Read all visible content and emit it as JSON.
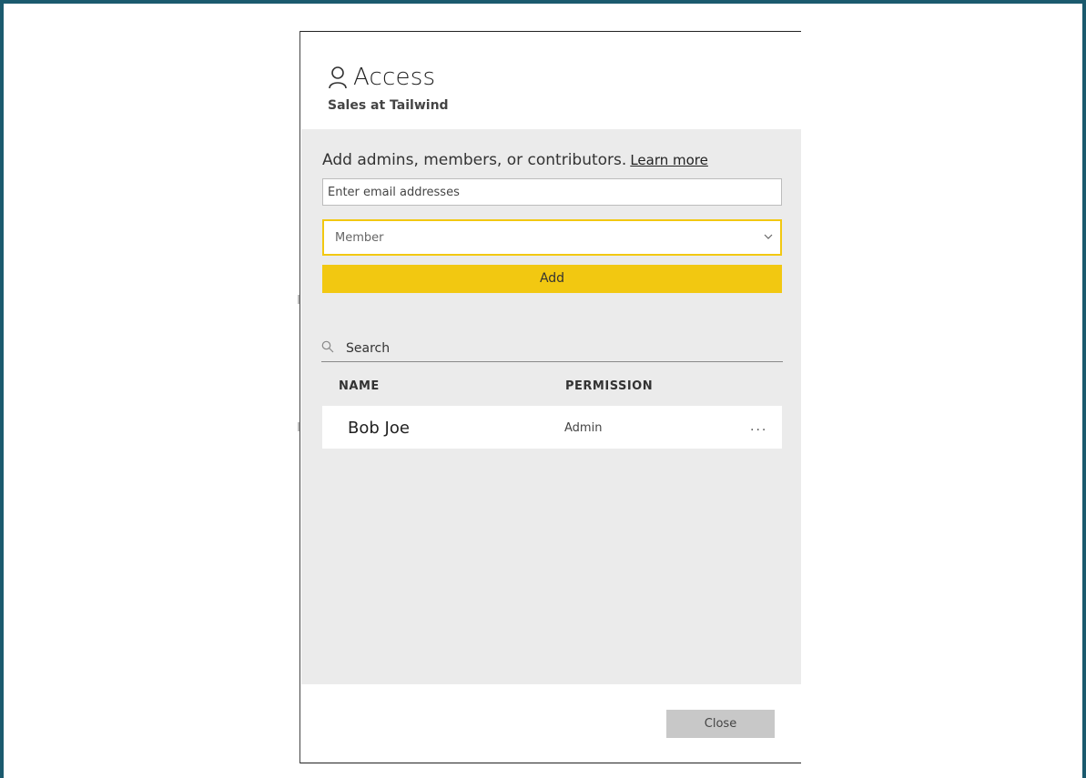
{
  "dialog": {
    "title": "Access",
    "subtitle": "Sales at Tailwind",
    "title_icon": "person-icon"
  },
  "add_section": {
    "intro": "Add admins, members, or contributors.",
    "learn_more": "Learn more",
    "email_placeholder": "Enter email addresses",
    "role_selected": "Member",
    "add_label": "Add"
  },
  "search": {
    "placeholder": "Search"
  },
  "table": {
    "headers": {
      "name": "NAME",
      "permission": "PERMISSION"
    },
    "rows": [
      {
        "name": "Bob Joe",
        "permission": "Admin",
        "more": "..."
      }
    ]
  },
  "footer": {
    "close_label": "Close"
  },
  "colors": {
    "accent": "#f2c811",
    "frame": "#1b5a6e",
    "panel_bg": "#ebebeb"
  }
}
